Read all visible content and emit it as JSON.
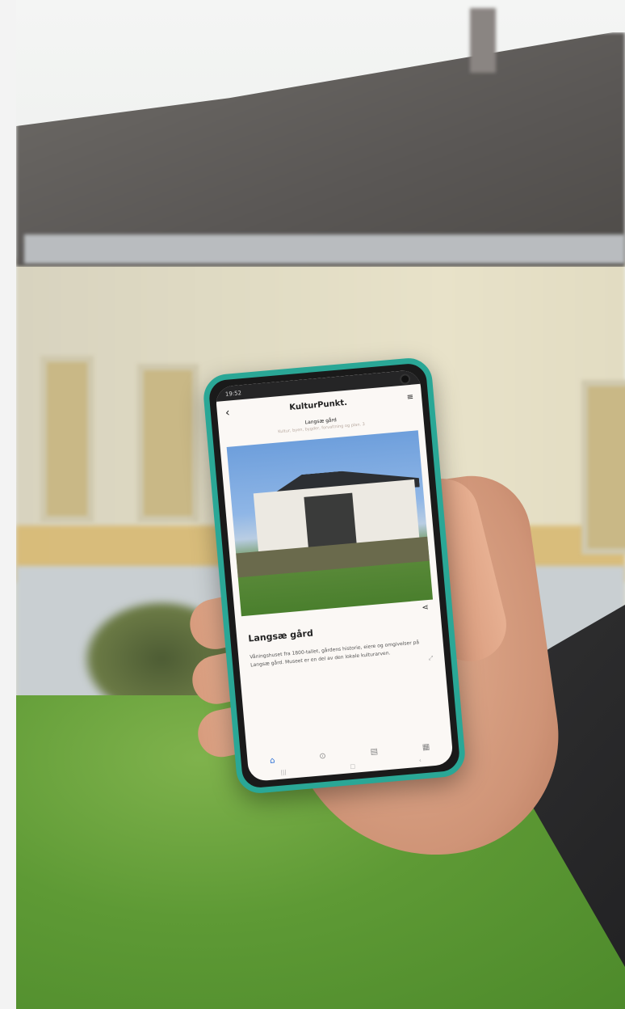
{
  "phone": {
    "status_time": "19:52",
    "app_brand": "KulturPunkt.",
    "back_icon": "chevron-left-icon",
    "menu_icon": "hamburger-menu-icon",
    "breadcrumb": "Langsæ gård",
    "subtitle": "Kultur, byen, bygder, forvaltning og plan. 3",
    "card": {
      "title": "Langsæ gård",
      "share_icon": "share-icon",
      "body": "Våningshuset fra 1800-tallet, gårdens historie, eiere og omgivelser på Langsæ gård. Museet er en del av den lokale kulturarven."
    },
    "nav_icons": [
      "home-icon",
      "map-pin-icon",
      "list-icon",
      "grid-icon"
    ],
    "system_nav": [
      "|||",
      "□",
      "‹"
    ]
  },
  "colors": {
    "phone_case": "#2aa796",
    "nav_active": "#2b6fd6"
  }
}
